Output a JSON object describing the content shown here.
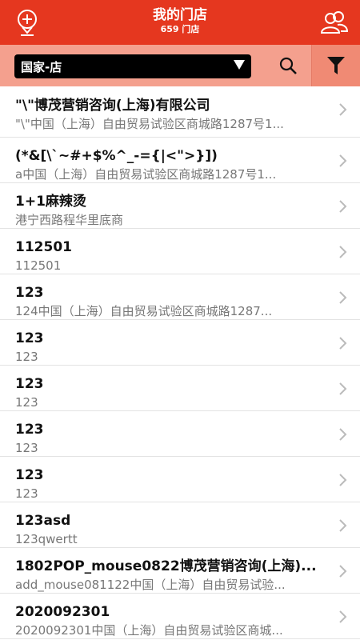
{
  "header": {
    "title": "我的门店",
    "subtitle": "659 门店",
    "left_icon": "add-location-icon",
    "right_icon": "people-icon"
  },
  "filter": {
    "selected": "国家-店",
    "search_icon": "search-icon",
    "filter_icon": "funnel-icon"
  },
  "stores": [
    {
      "name": "\"\\\"博茂营销咨询(上海)有限公司",
      "address": "\"\\\"中国（上海）自由贸易试验区商城路1287号1..."
    },
    {
      "name": "(*&[\\`~#+$%^_-={|<\">}])",
      "address": "a中国（上海）自由贸易试验区商城路1287号1..."
    },
    {
      "name": "1+1麻辣烫",
      "address": "港宁西路程华里底商"
    },
    {
      "name": "112501",
      "address": "112501"
    },
    {
      "name": "123",
      "address": "124中国（上海）自由贸易试验区商城路1287..."
    },
    {
      "name": "123",
      "address": "123"
    },
    {
      "name": "123",
      "address": "123"
    },
    {
      "name": "123",
      "address": "123"
    },
    {
      "name": "123",
      "address": "123"
    },
    {
      "name": "123asd",
      "address": "123qwertt"
    },
    {
      "name": "1802POP_mouse0822博茂营销咨询(上海)...",
      "address": "add_mouse081122中国（上海）自由贸易试验..."
    },
    {
      "name": "2020092301",
      "address": "2020092301中国（上海）自由贸易试验区商城..."
    }
  ],
  "colors": {
    "header_bg": "#e5371f",
    "filter_bg": "#f4a08e"
  }
}
